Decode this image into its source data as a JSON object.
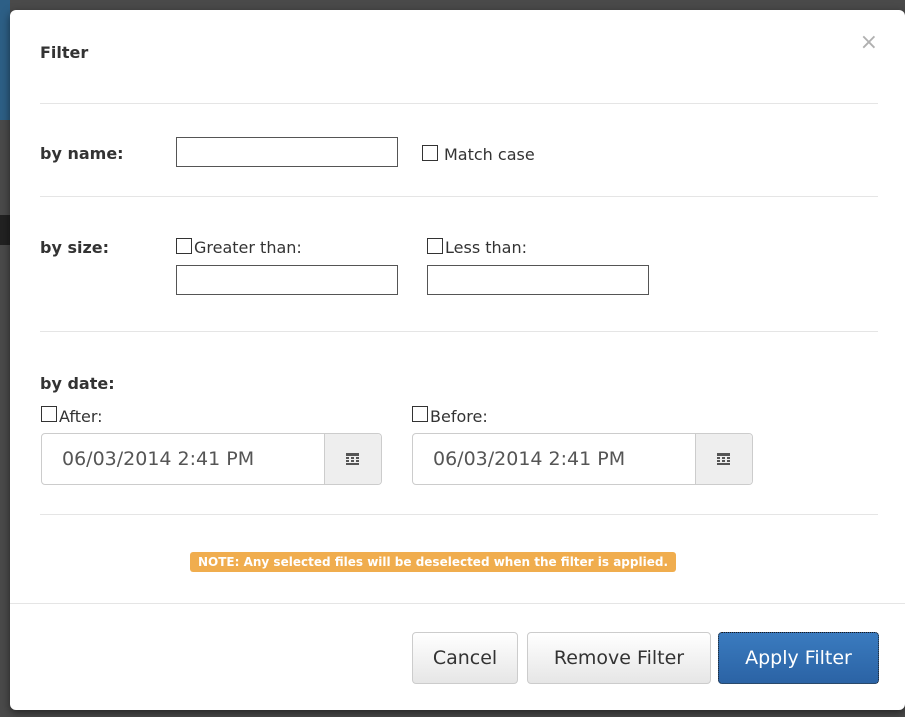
{
  "dialog": {
    "title": "Filter",
    "close_symbol": "×"
  },
  "by_name": {
    "label": "by name:",
    "value": "",
    "match_case_label": "Match case",
    "match_case_checked": false
  },
  "by_size": {
    "label": "by size:",
    "greater_than_label": "Greater than:",
    "greater_than_value": "",
    "less_than_label": "Less than:",
    "less_than_value": ""
  },
  "by_date": {
    "label": "by date:",
    "after_label": "After:",
    "after_value": "06/03/2014 2:41 PM",
    "before_label": "Before:",
    "before_value": "06/03/2014 2:41 PM"
  },
  "note": "NOTE: Any selected files will be deselected when the filter is applied.",
  "buttons": {
    "cancel": "Cancel",
    "remove": "Remove Filter",
    "apply": "Apply Filter"
  },
  "colors": {
    "note_bg": "#f0ad4e",
    "primary": "#2b63a5"
  },
  "icons": {
    "close": "close-icon",
    "calendar": "calendar-icon"
  }
}
